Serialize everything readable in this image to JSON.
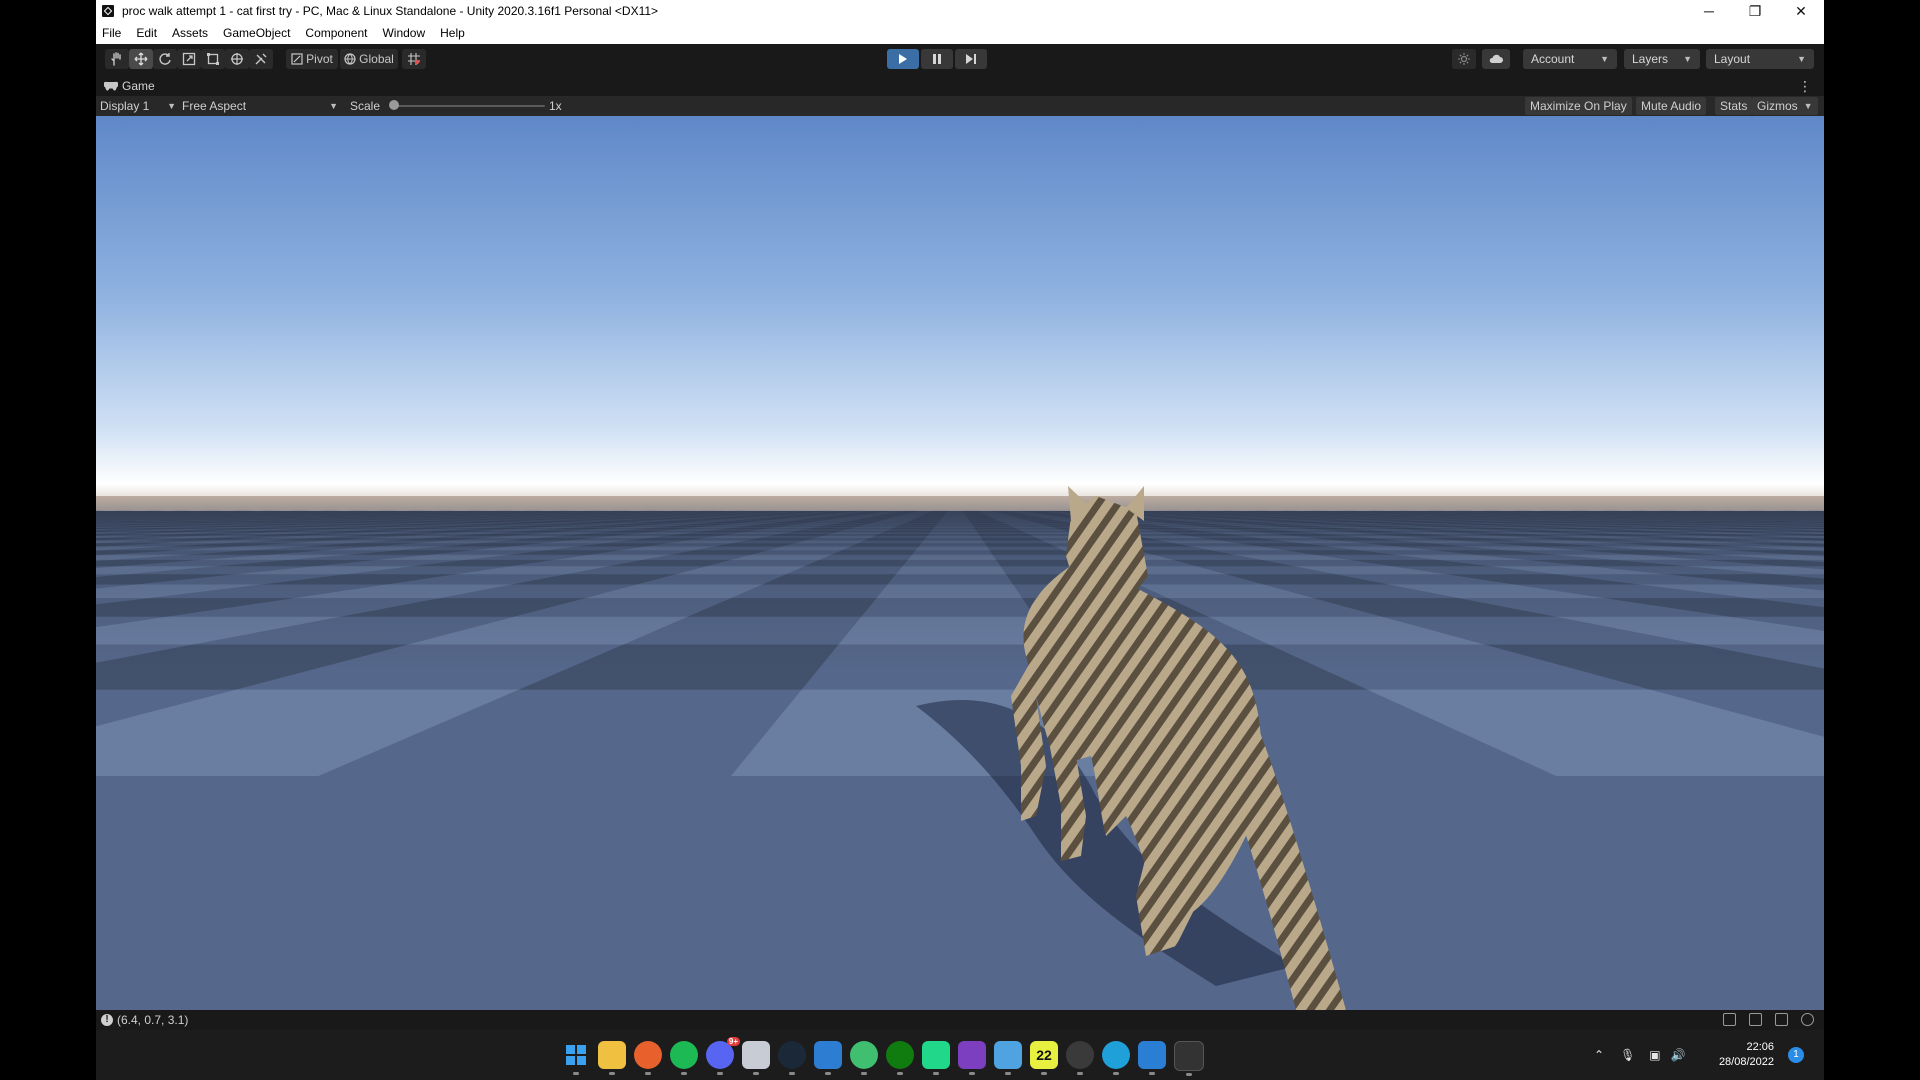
{
  "window": {
    "title": "proc walk attempt 1 - cat first try - PC, Mac & Linux Standalone - Unity 2020.3.16f1 Personal <DX11>",
    "controls": {
      "minimize": "─",
      "restore": "❐",
      "close": "✕"
    }
  },
  "menu": [
    "File",
    "Edit",
    "Assets",
    "GameObject",
    "Component",
    "Window",
    "Help"
  ],
  "toolbar": {
    "tools": [
      "hand-tool",
      "move-tool",
      "rotate-tool",
      "scale-tool",
      "rect-tool",
      "transform-tool",
      "custom-tool"
    ],
    "pivot_label": "Pivot",
    "global_label": "Global",
    "account_label": "Account",
    "layers_label": "Layers",
    "layout_label": "Layout"
  },
  "game": {
    "tab_label": "Game",
    "display": "Display 1",
    "aspect": "Free Aspect",
    "scale_label": "Scale",
    "scale_value": "1x",
    "scale_fraction": 0,
    "maximize_label": "Maximize On Play",
    "mute_label": "Mute Audio",
    "stats_label": "Stats",
    "gizmos_label": "Gizmos"
  },
  "status": {
    "message": "(6.4, 0.7, 3.1)"
  },
  "taskbar": {
    "apps": [
      "windows-start",
      "file-explorer",
      "firefox",
      "spotify",
      "discord",
      "mail",
      "steam",
      "photos",
      "xbox-app",
      "xbox",
      "pycharm",
      "visual-studio",
      "notepad",
      "pycharm-22",
      "photo-app",
      "edge",
      "store",
      "unity"
    ],
    "discord_badge": "9+",
    "pycharm_label": "22",
    "time": "22:06",
    "date": "28/08/2022",
    "notification_count": "1"
  },
  "colors": {
    "accent": "#3a6ea5",
    "sky_top": "#5f88c8",
    "sky_horizon": "#ffffff",
    "floor_dark": "#3f4d66",
    "floor_light": "#6f83a6"
  }
}
